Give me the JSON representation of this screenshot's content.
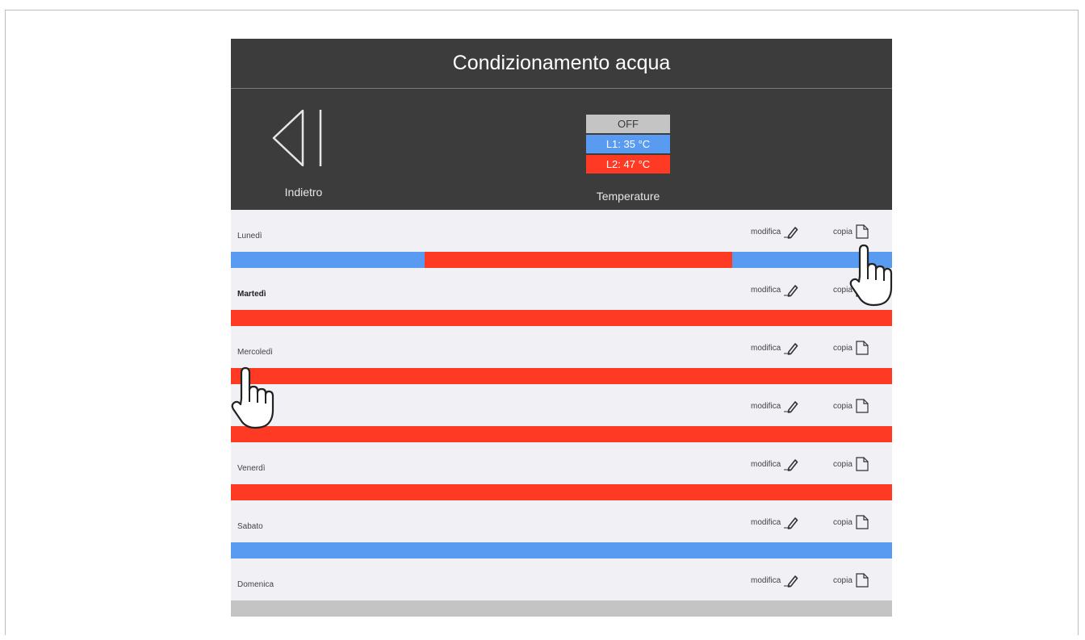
{
  "header": {
    "title": "Condizionamento acqua"
  },
  "nav": {
    "back_label": "Indietro",
    "temps_label": "Temperature"
  },
  "temperatures": {
    "off": "OFF",
    "l1": "L1: 35 °C",
    "l2": "L2: 47 °C"
  },
  "actions": {
    "edit": "modifica",
    "copy": "copia"
  },
  "colors": {
    "header_bg": "#3c3c3c",
    "l1": "#5a9bf2",
    "l2": "#ff3a24",
    "off": "#c4c4c4",
    "row_bg": "#f0f0f5"
  },
  "days": [
    {
      "name": "Lunedì",
      "schedule": "L1 / L2 / L1"
    },
    {
      "name": "Martedì",
      "schedule": "L2"
    },
    {
      "name": "Mercoledì",
      "schedule": "L2"
    },
    {
      "name": "",
      "schedule": "L2"
    },
    {
      "name": "Venerdì",
      "schedule": "L2"
    },
    {
      "name": "Sabato",
      "schedule": "L1"
    },
    {
      "name": "Domenica",
      "schedule": "OFF"
    }
  ]
}
